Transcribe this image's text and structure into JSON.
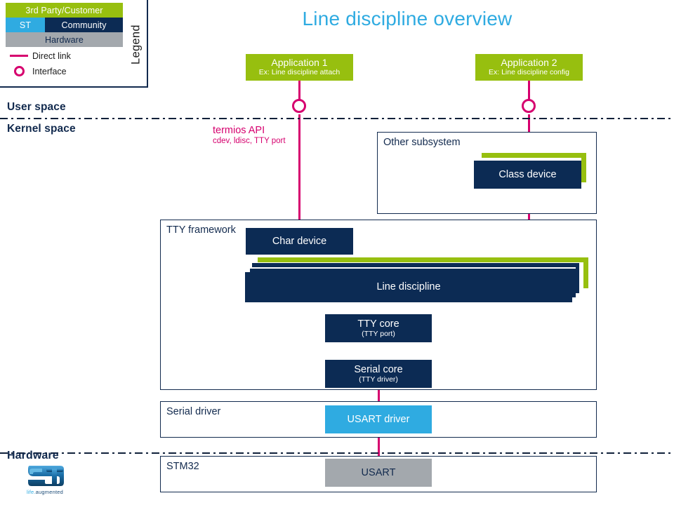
{
  "title": "Line discipline overview",
  "legend": {
    "vertical_label": "Legend",
    "bars": [
      {
        "label": "3rd Party/Customer",
        "color": "#97BF0F",
        "text_color": "#FFFFFF"
      },
      {
        "label": "ST",
        "color": "#2FABE1",
        "text_color": "#FFFFFF"
      },
      {
        "label": "Community",
        "color": "#0C2B54",
        "text_color": "#FFFFFF"
      },
      {
        "label": "Hardware",
        "color": "#A3A8AD",
        "text_color": "#122A4E"
      }
    ],
    "keys": [
      {
        "glyph": "line-glyph",
        "label": "Direct link",
        "color": "#D6006E"
      },
      {
        "glyph": "circle-glyph",
        "label": "Interface",
        "color": "#D6006E"
      }
    ]
  },
  "bands": {
    "user_space": "User space",
    "kernel_space": "Kernel space",
    "hardware": "Hardware"
  },
  "annotations": {
    "termios_title": "termios API",
    "termios_sub": "cdev, ldisc, TTY port"
  },
  "frames": {
    "other_subsystem": "Other subsystem",
    "tty_framework": "TTY framework",
    "serial_driver": "Serial driver",
    "stm32": "STM32"
  },
  "blocks": {
    "app1": {
      "title": "Application 1",
      "subtitle": "Ex: Line discipline attach",
      "color": "#97BF0F"
    },
    "app2": {
      "title": "Application 2",
      "subtitle": "Ex: Line discipline config",
      "color": "#97BF0F"
    },
    "class_device": {
      "title": "Class device",
      "color": "#0C2B54"
    },
    "char_device": {
      "title": "Char device",
      "color": "#0C2B54"
    },
    "line_discipline": {
      "title": "Line discipline",
      "color": "#0C2B54"
    },
    "tty_core": {
      "title": "TTY core",
      "subtitle": "(TTY port)",
      "color": "#0C2B54"
    },
    "serial_core": {
      "title": "Serial core",
      "subtitle": "(TTY driver)",
      "color": "#0C2B54"
    },
    "usart_driver": {
      "title": "USART driver",
      "color": "#2FABE1"
    },
    "usart": {
      "title": "USART",
      "color": "#A3A8AD"
    }
  },
  "logo": {
    "name": "ST",
    "tagline_accent": "life.",
    "tagline_rest": "augmented"
  },
  "colors": {
    "accent_green": "#97BF0F",
    "accent_navy": "#0C2B54",
    "accent_cyan": "#2FABE1",
    "accent_gray": "#A3A8AD",
    "link_magenta": "#D6006E",
    "title_blue": "#2FABE1",
    "border_navy": "#122A4E"
  }
}
